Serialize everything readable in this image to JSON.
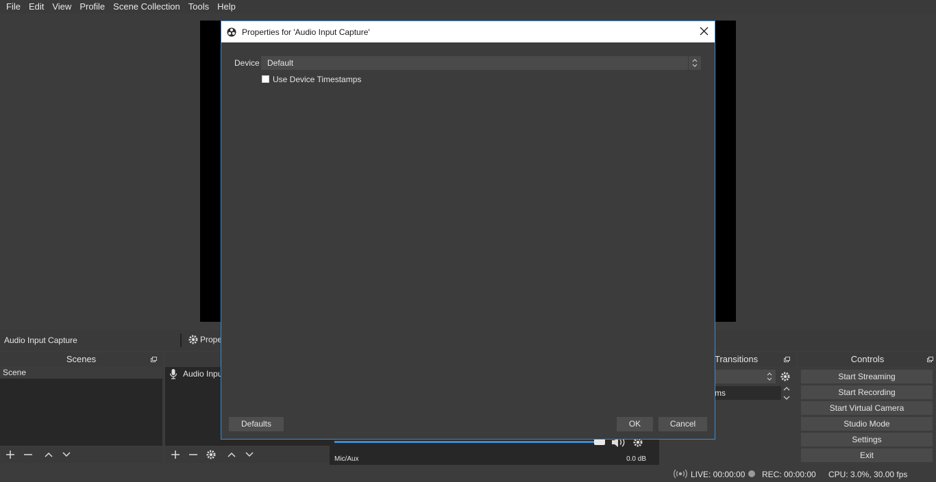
{
  "menu": [
    "File",
    "Edit",
    "View",
    "Profile",
    "Scene Collection",
    "Tools",
    "Help"
  ],
  "source_bar": {
    "selected_source": "Audio Input Capture",
    "properties_label": "Proper"
  },
  "docks": {
    "scenes": {
      "title": "Scenes",
      "items": [
        "Scene"
      ]
    },
    "sources": {
      "items": [
        "Audio Input"
      ]
    },
    "mixer": {
      "channel": "Mic/Aux",
      "level": "0.0 dB",
      "volume": 1.0
    },
    "transitions": {
      "title": "Transitions",
      "duration_suffix": "ms"
    },
    "controls": {
      "title": "Controls",
      "buttons": [
        "Start Streaming",
        "Start Recording",
        "Start Virtual Camera",
        "Studio Mode",
        "Settings",
        "Exit"
      ]
    }
  },
  "status": {
    "live": "LIVE: 00:00:00",
    "rec": "REC: 00:00:00",
    "cpu": "CPU: 3.0%, 30.00 fps"
  },
  "dialog": {
    "title": "Properties for 'Audio Input Capture'",
    "device_label": "Device",
    "device_value": "Default",
    "timestamps_label": "Use Device Timestamps",
    "timestamps_checked": false,
    "defaults_label": "Defaults",
    "ok_label": "OK",
    "cancel_label": "Cancel"
  },
  "colors": {
    "accent": "#3d8bd8",
    "background": "#3c3c3c",
    "dock": "#272727",
    "button": "#4a4a4a"
  }
}
